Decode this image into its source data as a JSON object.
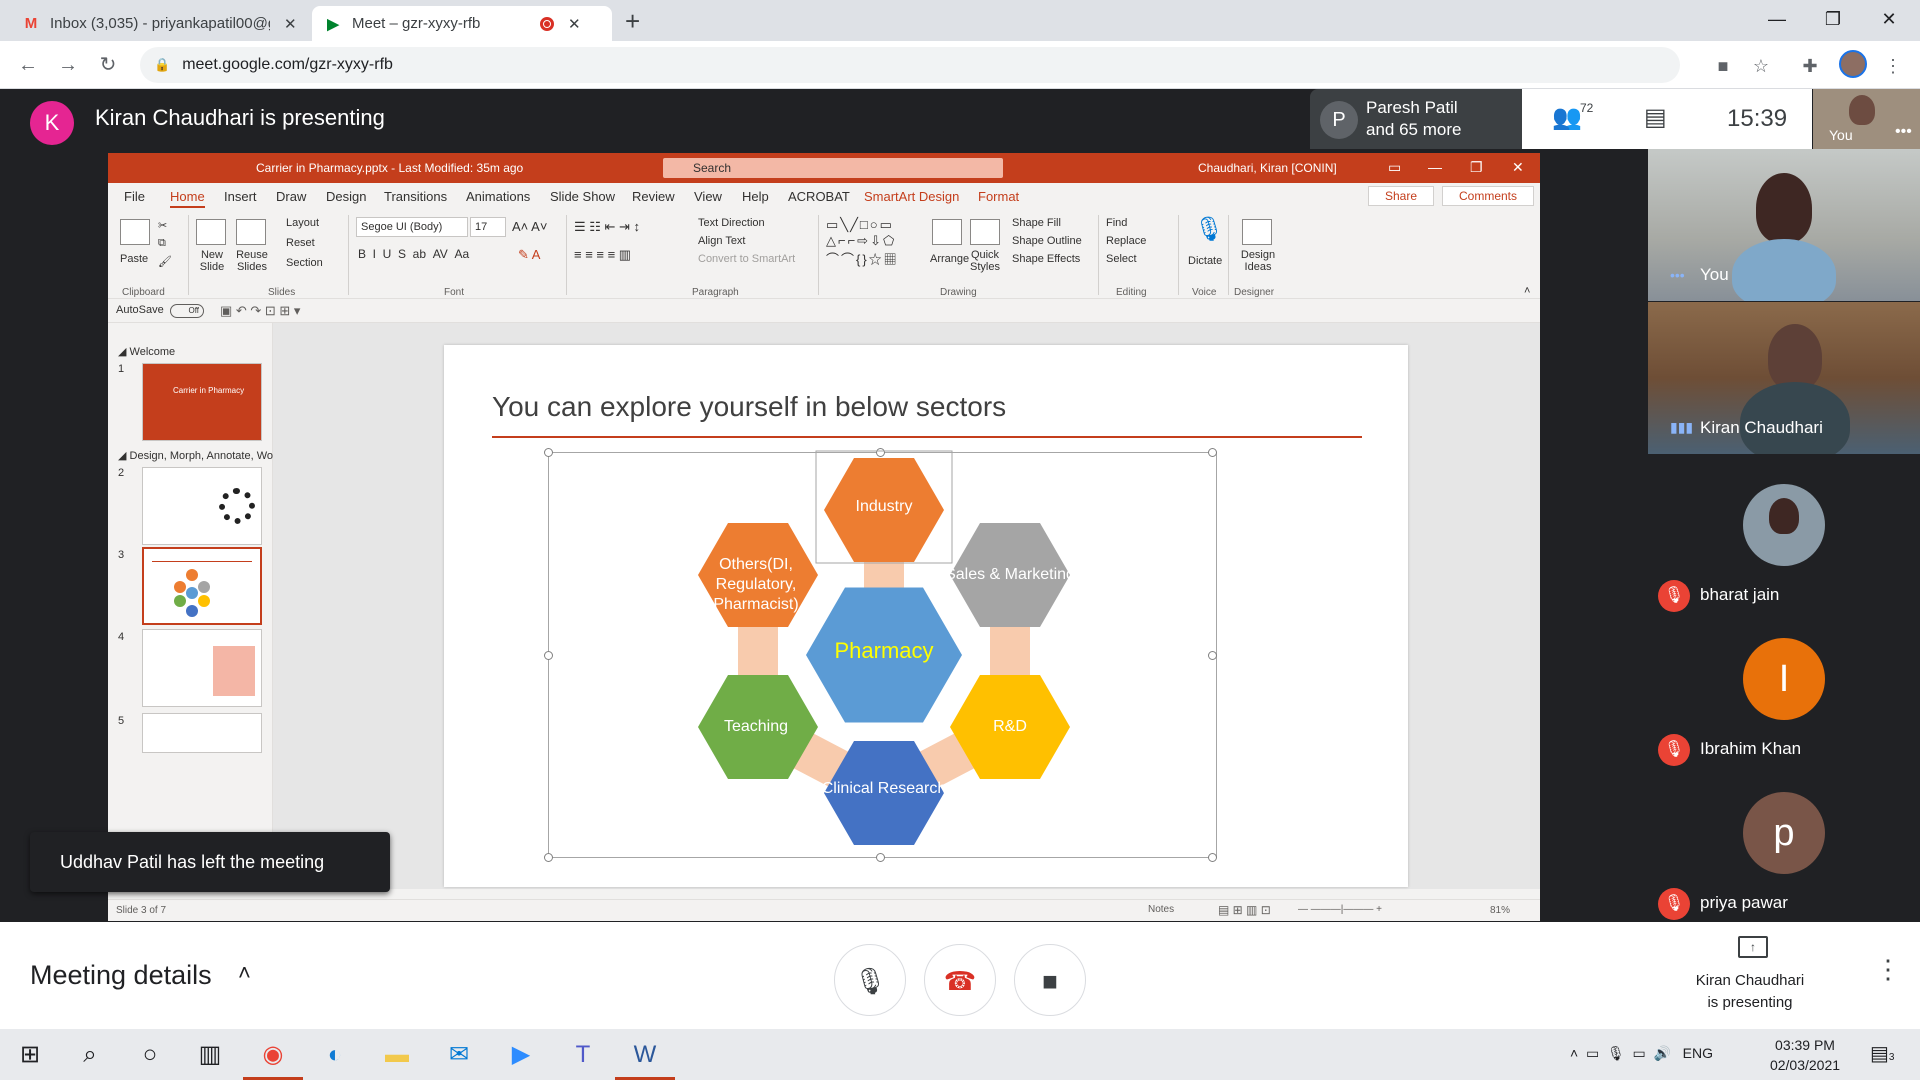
{
  "browser": {
    "tabs": [
      {
        "title": "Inbox (3,035) - priyankapatil00@g",
        "favicon": "gmail-icon"
      },
      {
        "title": "Meet – gzr-xyxy-rfb",
        "favicon": "meet-icon",
        "recording": true
      }
    ],
    "url": "meet.google.com/gzr-xyxy-rfb"
  },
  "meet": {
    "presenter_initial": "K",
    "presenting_text": "Kiran Chaudhari is presenting",
    "chip_initial": "P",
    "chip_name_line1": "Paresh Patil",
    "chip_name_line2": "and 65 more",
    "people_count": "72",
    "clock": "15:39",
    "self_mini_label": "You",
    "tiles": {
      "you": "You",
      "kiran": "Kiran Chaudhari"
    },
    "participants": [
      {
        "name": "bharat jain",
        "initial": "",
        "color": "#8a9aa6"
      },
      {
        "name": "Ibrahim Khan",
        "initial": "I",
        "color": "#e8710a"
      },
      {
        "name": "priya pawar",
        "initial": "p",
        "color": "#795548"
      }
    ],
    "toast": "Uddhav Patil has left the meeting",
    "meeting_details": "Meeting details",
    "present_line1": "Kiran Chaudhari",
    "present_line2": "is presenting"
  },
  "ppt": {
    "title": "Carrier in Pharmacy.pptx - Last Modified: 35m ago",
    "search": "Search",
    "user": "Chaudhari, Kiran [CONIN]",
    "menu": [
      "File",
      "Home",
      "Insert",
      "Draw",
      "Design",
      "Transitions",
      "Animations",
      "Slide Show",
      "Review",
      "View",
      "Help",
      "ACROBAT",
      "SmartArt Design",
      "Format"
    ],
    "share": "Share",
    "comments": "Comments",
    "ribbon": {
      "paste": "Paste",
      "new_slide": "New Slide",
      "reuse_slides": "Reuse Slides",
      "layout": "Layout",
      "reset": "Reset",
      "section": "Section",
      "font_name": "Segoe UI (Body)",
      "font_size": "17",
      "text_direction": "Text Direction",
      "align_text": "Align Text",
      "convert_smartart": "Convert to SmartArt",
      "arrange": "Arrange",
      "quick_styles": "Quick Styles",
      "shape_fill": "Shape Fill",
      "shape_outline": "Shape Outline",
      "shape_effects": "Shape Effects",
      "find": "Find",
      "replace": "Replace",
      "select": "Select",
      "dictate": "Dictate",
      "design_ideas": "Design Ideas",
      "groups": [
        "Clipboard",
        "Slides",
        "Font",
        "Paragraph",
        "Drawing",
        "Editing",
        "Voice",
        "Designer"
      ]
    },
    "autosave": "AutoSave",
    "autosave_state": "Off",
    "sections": [
      "Welcome",
      "Design, Morph, Annotate, Wo..."
    ],
    "thumbs": [
      {
        "num": "1",
        "text": "Carrier in Pharmacy"
      },
      {
        "num": "2",
        "text": ""
      },
      {
        "num": "3",
        "text": ""
      },
      {
        "num": "4",
        "text": ""
      },
      {
        "num": "5",
        "text": ""
      }
    ],
    "slide": {
      "title": "You can explore yourself in below sectors",
      "center": "Pharmacy",
      "hexes": {
        "top": "Industry",
        "upper_left": "Others(DI, Regulatory, Pharmacist)",
        "upper_right": "Sales & Marketing",
        "lower_left": "Teaching",
        "lower_right": "R&D",
        "bottom": "Clinical Research"
      },
      "colors": {
        "orange": "#ed7d31",
        "gray": "#a5a5a5",
        "blue": "#5b9bd5",
        "green": "#70ad47",
        "gold": "#ffc000",
        "darkblue": "#4472c4",
        "accent": "#c43e1c",
        "pharmacy_text": "#ffff00"
      }
    },
    "status": {
      "slide_of": "Slide 3 of 7",
      "notes": "Notes",
      "zoom": "81%"
    }
  },
  "taskbar": {
    "lang": "ENG",
    "time": "03:39 PM",
    "date": "02/03/2021",
    "notif_count": "3"
  }
}
